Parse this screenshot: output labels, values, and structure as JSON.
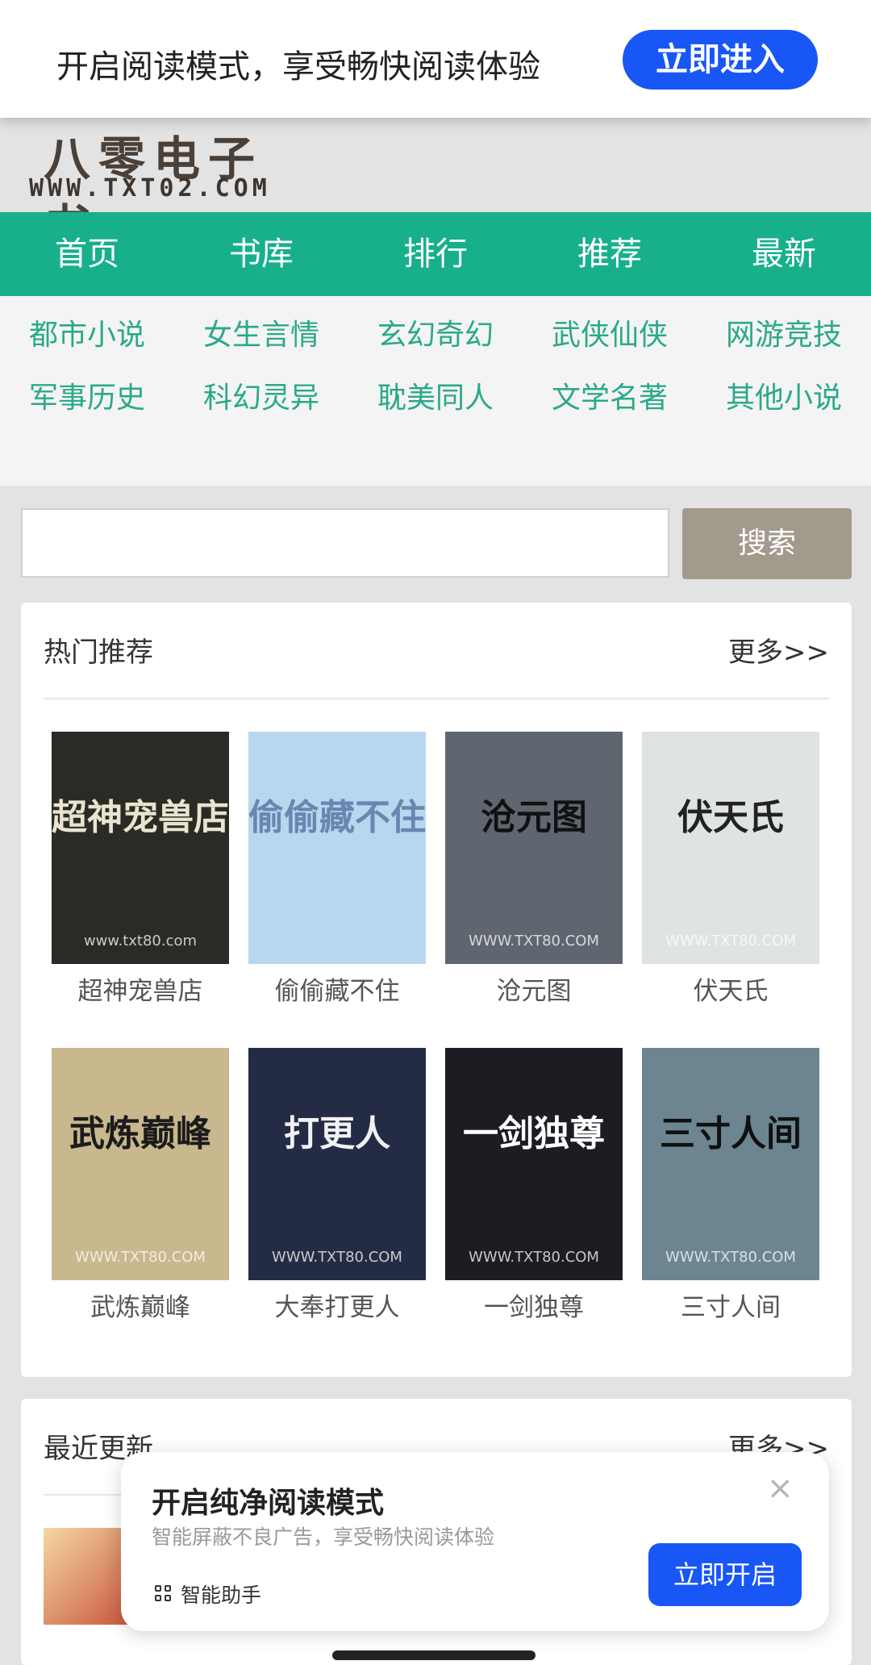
{
  "top_banner": {
    "message": "开启阅读模式，享受畅快阅读体验",
    "button": "立即进入"
  },
  "logo": {
    "name": "八零电子书",
    "url": "WWW.TXT02.COM"
  },
  "main_nav": [
    "首页",
    "书库",
    "排行",
    "推荐",
    "最新"
  ],
  "categories": [
    [
      "都市小说",
      "女生言情",
      "玄幻奇幻",
      "武侠仙侠",
      "网游竞技"
    ],
    [
      "军事历史",
      "科幻灵异",
      "耽美同人",
      "文学名著",
      "其他小说"
    ]
  ],
  "search": {
    "placeholder": "",
    "button": "搜索"
  },
  "hot": {
    "title": "热门推荐",
    "more": "更多>>",
    "books": [
      {
        "title": "超神宠兽店",
        "cover_text": "超神宠兽店",
        "watermark": "www.txt80.com",
        "bg": "#2b2a24",
        "fg": "#e9e4d0"
      },
      {
        "title": "偷偷藏不住",
        "cover_text": "偷偷藏不住",
        "watermark": "",
        "bg": "#b9d6ef",
        "fg": "#6a86b0"
      },
      {
        "title": "沧元图",
        "cover_text": "沧元图",
        "watermark": "WWW.TXT80.COM",
        "bg": "#5f6670",
        "fg": "#111111"
      },
      {
        "title": "伏天氏",
        "cover_text": "伏天氏",
        "watermark": "WWW.TXT80.COM",
        "bg": "#dfe3e3",
        "fg": "#222222"
      },
      {
        "title": "武炼巅峰",
        "cover_text": "武炼巅峰",
        "watermark": "WWW.TXT80.COM",
        "bg": "#c9b78e",
        "fg": "#1b1b1b"
      },
      {
        "title": "大奉打更人",
        "cover_text": "打更人",
        "watermark": "WWW.TXT80.COM",
        "bg": "#242c45",
        "fg": "#f2f2f2"
      },
      {
        "title": "一剑独尊",
        "cover_text": "一剑独尊",
        "watermark": "WWW.TXT80.COM",
        "bg": "#1c1c22",
        "fg": "#ffffff"
      },
      {
        "title": "三寸人间",
        "cover_text": "三寸人间",
        "watermark": "WWW.TXT80.COM",
        "bg": "#6d8590",
        "fg": "#101010"
      }
    ]
  },
  "recent": {
    "title": "最近更新",
    "more": "更多>>"
  },
  "popup": {
    "title": "开启纯净阅读模式",
    "subtitle": "智能屏蔽不良广告，享受畅快阅读体验",
    "close": "×",
    "helper": "智能助手",
    "button": "立即开启"
  }
}
